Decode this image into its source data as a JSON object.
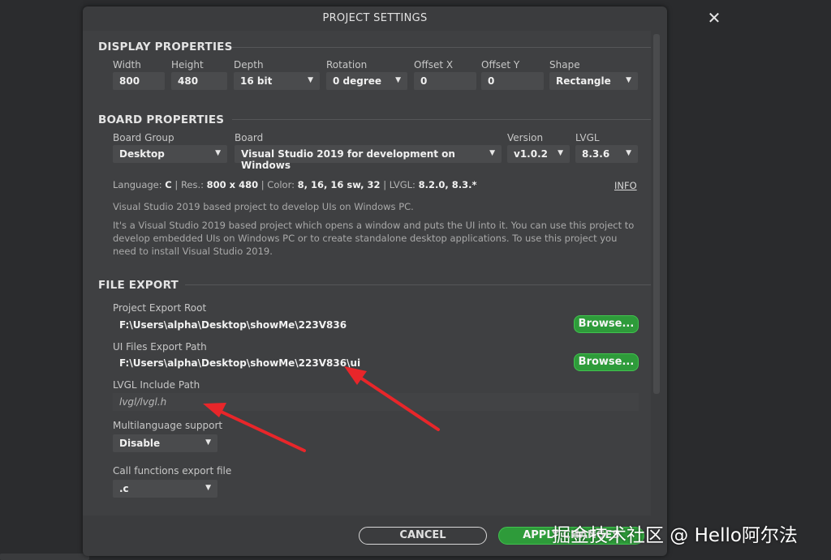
{
  "dialog": {
    "title": "PROJECT SETTINGS",
    "close_glyph": "✕"
  },
  "display": {
    "title": "DISPLAY PROPERTIES",
    "width_label": "Width",
    "width_value": "800",
    "height_label": "Height",
    "height_value": "480",
    "depth_label": "Depth",
    "depth_value": "16 bit",
    "rotation_label": "Rotation",
    "rotation_value": "0 degree",
    "offset_x_label": "Offset X",
    "offset_x_value": "0",
    "offset_y_label": "Offset Y",
    "offset_y_value": "0",
    "shape_label": "Shape",
    "shape_value": "Rectangle"
  },
  "board": {
    "title": "BOARD PROPERTIES",
    "group_label": "Board Group",
    "group_value": "Desktop",
    "board_label": "Board",
    "board_value": "Visual Studio 2019 for development on Windows",
    "version_label": "Version",
    "version_value": "v1.0.2",
    "lvgl_label": "LVGL",
    "lvgl_value": "8.3.6",
    "info": {
      "language_label": "Language:",
      "language_value": "C",
      "res_label": "Res.:",
      "res_value": "800 x 480",
      "color_label": "Color:",
      "color_value": "8, 16, 16 sw, 32",
      "lvgl_label": "LVGL:",
      "lvgl_value": "8.2.0, 8.3.*",
      "link": "INFO"
    },
    "desc_short": "Visual Studio 2019 based project to develop UIs on Windows PC.",
    "desc_long": "It's a Visual Studio 2019 based project which opens a window and puts the UI into it. You can use this project to develop embedded UIs on Windows PC or to create standalone desktop applications. To use this project you need to install Visual Studio 2019."
  },
  "export": {
    "title": "FILE EXPORT",
    "project_root_label": "Project Export Root",
    "project_root_value": "F:\\Users\\alpha\\Desktop\\showMe\\223V836",
    "ui_path_label": "UI Files Export Path",
    "ui_path_value": "F:\\Users\\alpha\\Desktop\\showMe\\223V836\\ui",
    "browse_label": "Browse...",
    "lvgl_include_label": "LVGL Include Path",
    "lvgl_include_value": "lvgl/lvgl.h",
    "multilang_label": "Multilanguage support",
    "multilang_value": "Disable",
    "callfn_label": "Call functions export file",
    "callfn_value": ".c"
  },
  "footer": {
    "cancel": "CANCEL",
    "apply": "APPLY CHANGES"
  },
  "watermark": "掘金技术社区 @ Hello阿尔法",
  "colors": {
    "accent_green": "#2e9b3a",
    "annotation_red": "#e8262a",
    "dialog_bg": "#3b3c3e"
  }
}
